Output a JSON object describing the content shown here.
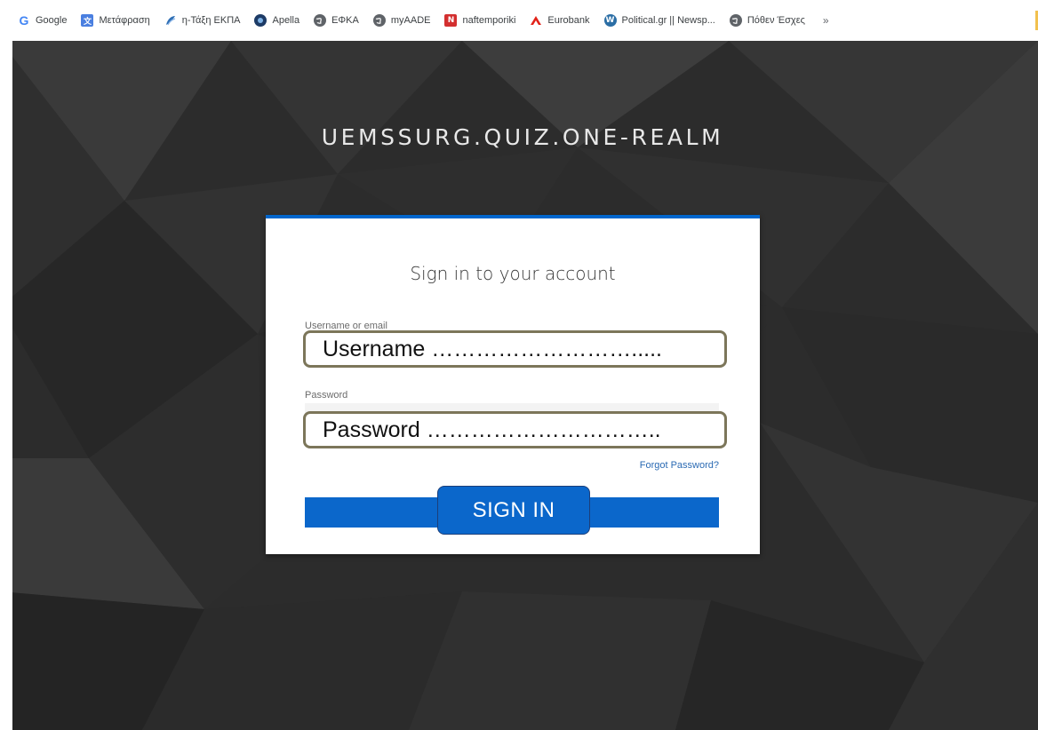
{
  "bookmarks": {
    "items": [
      {
        "label": "Google",
        "icon": "google-g-icon"
      },
      {
        "label": "Μετάφραση",
        "icon": "translate-icon"
      },
      {
        "label": "η-Τάξη ΕΚΠΑ",
        "icon": "eclass-icon"
      },
      {
        "label": "Apella",
        "icon": "apella-icon"
      },
      {
        "label": "ΕΦΚΑ",
        "icon": "globe-icon"
      },
      {
        "label": "myAADE",
        "icon": "globe-icon"
      },
      {
        "label": "naftemporiki",
        "icon": "naftemporiki-icon"
      },
      {
        "label": "Eurobank",
        "icon": "eurobank-icon"
      },
      {
        "label": "Political.gr || Newsp...",
        "icon": "wordpress-icon"
      },
      {
        "label": "Πόθεν Έσχες",
        "icon": "globe-icon"
      }
    ],
    "more_label": "»"
  },
  "realm": {
    "title": "UEMSSURG.QUIZ.ONE-REALM"
  },
  "login": {
    "heading": "Sign in to your account",
    "username_label": "Username or email",
    "username_value": "Username ……………………….....",
    "password_label": "Password",
    "password_value": "Password  …………………………..",
    "forgot_password": "Forgot Password?",
    "sign_in": "SIGN IN"
  },
  "colors": {
    "accent": "#0066cc",
    "button": "#0b67cb",
    "annotation_border": "#7c765a",
    "background": "#2c2c2c"
  }
}
